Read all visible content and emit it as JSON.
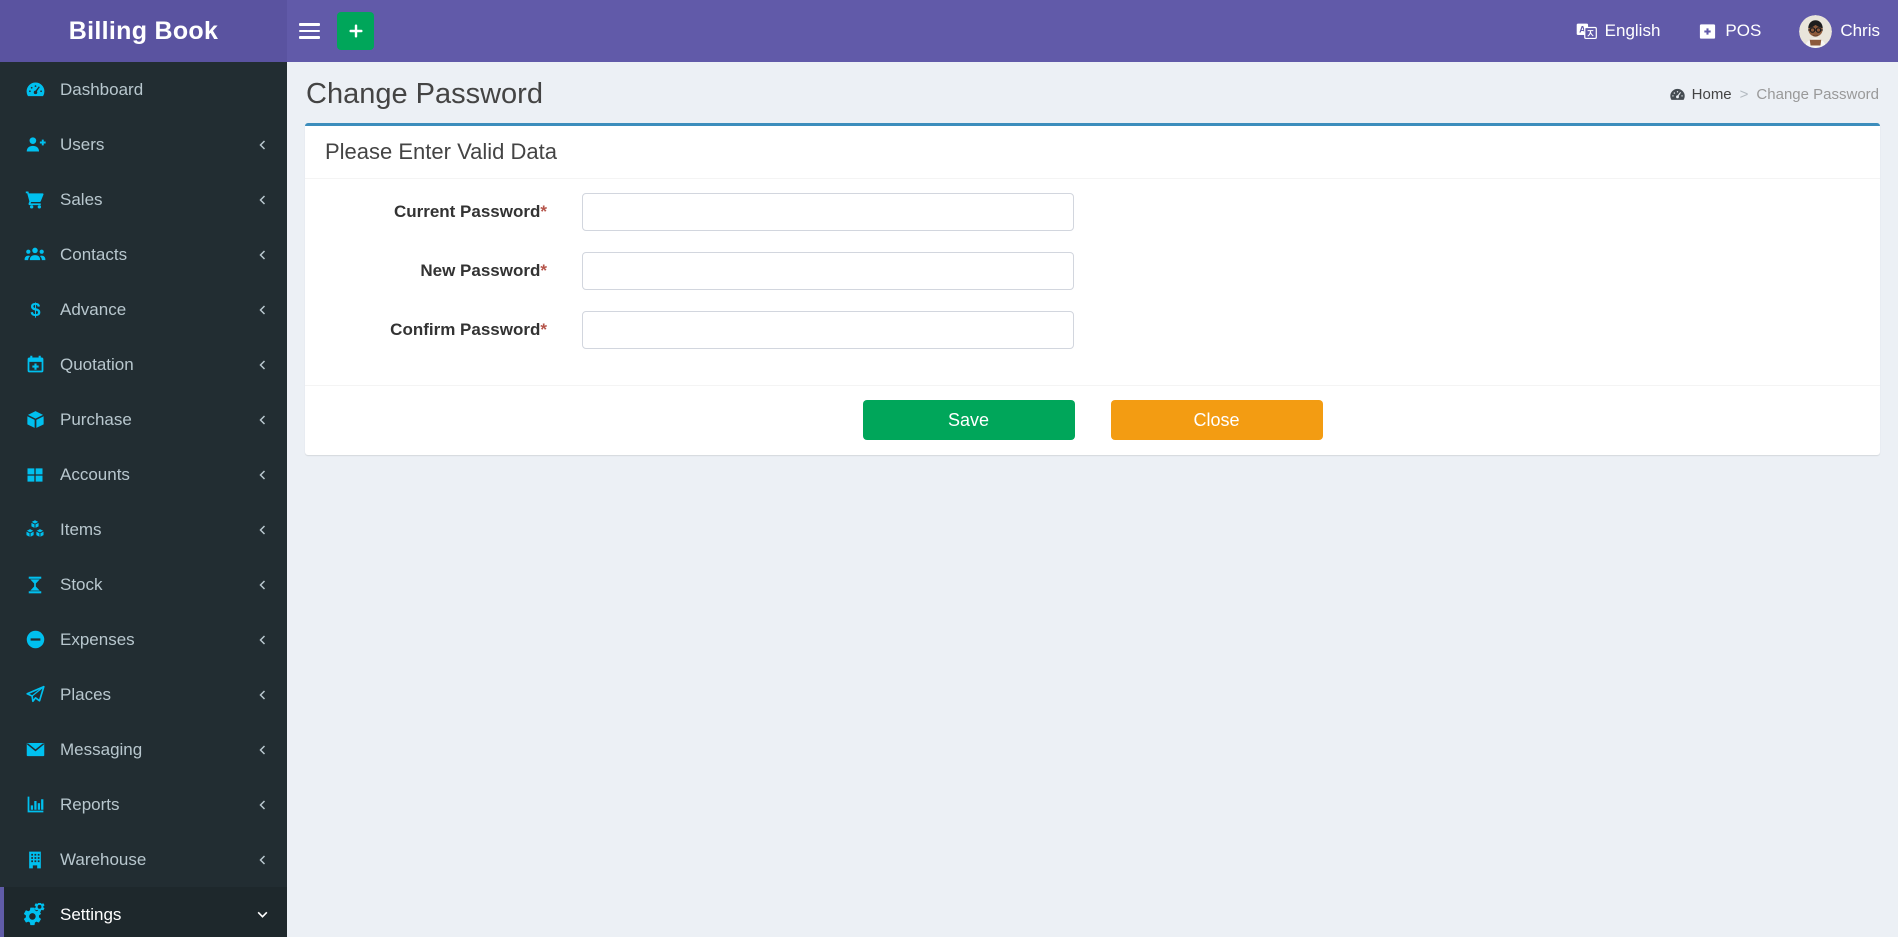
{
  "app": {
    "title": "Billing Book"
  },
  "topbar": {
    "language_label": "English",
    "pos_label": "POS",
    "username": "Chris"
  },
  "sidebar": {
    "items": [
      {
        "label": "Dashboard",
        "icon": "dashboard-icon",
        "has_submenu": false,
        "active": false
      },
      {
        "label": "Users",
        "icon": "user-plus-icon",
        "has_submenu": true,
        "active": false
      },
      {
        "label": "Sales",
        "icon": "cart-icon",
        "has_submenu": true,
        "active": false
      },
      {
        "label": "Contacts",
        "icon": "people-group-icon",
        "has_submenu": true,
        "active": false
      },
      {
        "label": "Advance",
        "icon": "dollar-icon",
        "has_submenu": true,
        "active": false
      },
      {
        "label": "Quotation",
        "icon": "calendar-plus-icon",
        "has_submenu": true,
        "active": false
      },
      {
        "label": "Purchase",
        "icon": "cube-icon",
        "has_submenu": true,
        "active": false
      },
      {
        "label": "Accounts",
        "icon": "grid-icon",
        "has_submenu": true,
        "active": false
      },
      {
        "label": "Items",
        "icon": "cubes-icon",
        "has_submenu": true,
        "active": false
      },
      {
        "label": "Stock",
        "icon": "hourglass-icon",
        "has_submenu": true,
        "active": false
      },
      {
        "label": "Expenses",
        "icon": "minus-circle-icon",
        "has_submenu": true,
        "active": false
      },
      {
        "label": "Places",
        "icon": "paper-plane-icon",
        "has_submenu": true,
        "active": false
      },
      {
        "label": "Messaging",
        "icon": "envelope-icon",
        "has_submenu": true,
        "active": false
      },
      {
        "label": "Reports",
        "icon": "bar-chart-icon",
        "has_submenu": true,
        "active": false
      },
      {
        "label": "Warehouse",
        "icon": "building-icon",
        "has_submenu": true,
        "active": false
      },
      {
        "label": "Settings",
        "icon": "gears-icon",
        "has_submenu": true,
        "active": true,
        "expanded": true
      }
    ]
  },
  "page": {
    "title": "Change Password",
    "breadcrumb": {
      "home": "Home",
      "separator": ">",
      "current": "Change Password"
    }
  },
  "form": {
    "header": "Please Enter Valid Data",
    "required_mark": "*",
    "fields": [
      {
        "label": "Current Password",
        "value": "",
        "type": "password"
      },
      {
        "label": "New Password",
        "value": "",
        "type": "password"
      },
      {
        "label": "Confirm Password",
        "value": "",
        "type": "password"
      }
    ],
    "buttons": {
      "save": "Save",
      "close": "Close"
    }
  },
  "colors": {
    "navbar": "#615aa9",
    "logo_bg": "#5a53a0",
    "sidebar_bg": "#222d32",
    "sidebar_active_bg": "#1e282c",
    "sidebar_active_border": "#605ca8",
    "icon_accent": "#00c0ef",
    "card_top_border": "#3c8dbc",
    "save_green": "#00a65a",
    "close_orange": "#f39c12",
    "required_red": "#b5544a",
    "content_bg": "#ecf0f5"
  }
}
